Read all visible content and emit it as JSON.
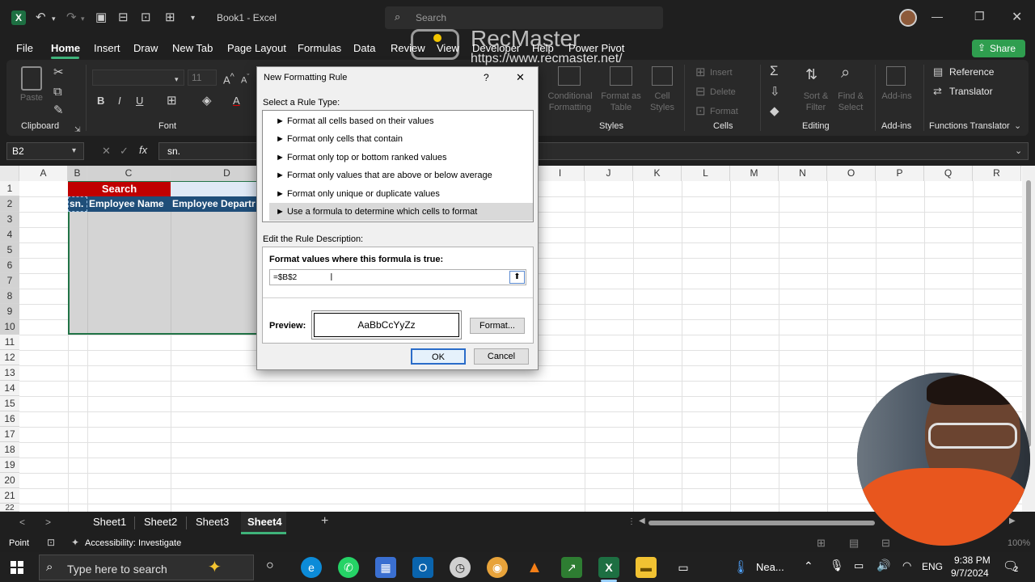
{
  "titlebar": {
    "title": "Book1 - Excel",
    "search_placeholder": "Search",
    "window_buttons": [
      "minimize",
      "restore",
      "close"
    ]
  },
  "watermark": {
    "name": "RecMaster",
    "url": "https://www.recmaster.net/"
  },
  "menu": {
    "items": [
      "File",
      "Home",
      "Insert",
      "Draw",
      "New Tab",
      "Page Layout",
      "Formulas",
      "Data",
      "Review",
      "View",
      "Developer",
      "Help",
      "Power Pivot"
    ],
    "active": "Home",
    "share_label": "Share"
  },
  "ribbon": {
    "groups": [
      "Clipboard",
      "Font",
      "Styles",
      "Cells",
      "Editing",
      "Add-ins",
      "Functions Translator"
    ],
    "paste_label": "Paste",
    "font_size": "11",
    "styles_buttons": [
      "Conditional Formatting",
      "Format as Table",
      "Cell Styles"
    ],
    "cells_buttons": [
      "Insert",
      "Delete",
      "Format"
    ],
    "editing_buttons": [
      "Sort & Filter",
      "Find & Select"
    ],
    "addins_label": "Add-ins",
    "reference_label": "Reference",
    "translator_label": "Translator"
  },
  "formula_bar": {
    "name_box": "B2",
    "fx": "fx",
    "content": "sn."
  },
  "grid": {
    "columns": [
      "A",
      "B",
      "C",
      "D",
      "I",
      "J",
      "K",
      "L",
      "M",
      "N",
      "O",
      "P",
      "Q",
      "R"
    ],
    "rows": [
      "1",
      "2",
      "3",
      "4",
      "5",
      "6",
      "7",
      "8",
      "9",
      "10",
      "11",
      "12",
      "13",
      "14",
      "15",
      "16",
      "17",
      "18",
      "19",
      "20",
      "21",
      "22"
    ],
    "search_cell": "Search",
    "headers": [
      "sn.",
      "Employee Name",
      "Employee Departr"
    ],
    "colors": {
      "search_bg": "#c00000",
      "header_bg": "#1f4e79",
      "selection_bg": "#d4d4d4",
      "border_green": "#217346"
    }
  },
  "dialog": {
    "title": "New Formatting Rule",
    "help": "?",
    "close": "✕",
    "select_label": "Select a Rule Type:",
    "rule_types": [
      "Format all cells based on their values",
      "Format only cells that contain",
      "Format only top or bottom ranked values",
      "Format only values that are above or below average",
      "Format only unique or duplicate values",
      "Use a formula to determine which cells to format"
    ],
    "selected_rule_index": 5,
    "edit_label": "Edit the Rule Description:",
    "formula_label": "Format values where this formula is true:",
    "formula_value": "=$B$2",
    "preview_label": "Preview:",
    "preview_text": "AaBbCcYyZz",
    "format_button": "Format...",
    "ok_button": "OK",
    "cancel_button": "Cancel"
  },
  "sheets": {
    "tabs": [
      "Sheet1",
      "Sheet2",
      "Sheet3",
      "Sheet4"
    ],
    "active": "Sheet4",
    "add": "+"
  },
  "status": {
    "mode": "Point",
    "accessibility": "Accessibility: Investigate",
    "zoom": "100%"
  },
  "taskbar": {
    "search_placeholder": "Type here to search",
    "weather": "Nea...",
    "language": "ENG",
    "time": "9:38 PM",
    "date": "9/7/2024",
    "notification_count": "2"
  }
}
